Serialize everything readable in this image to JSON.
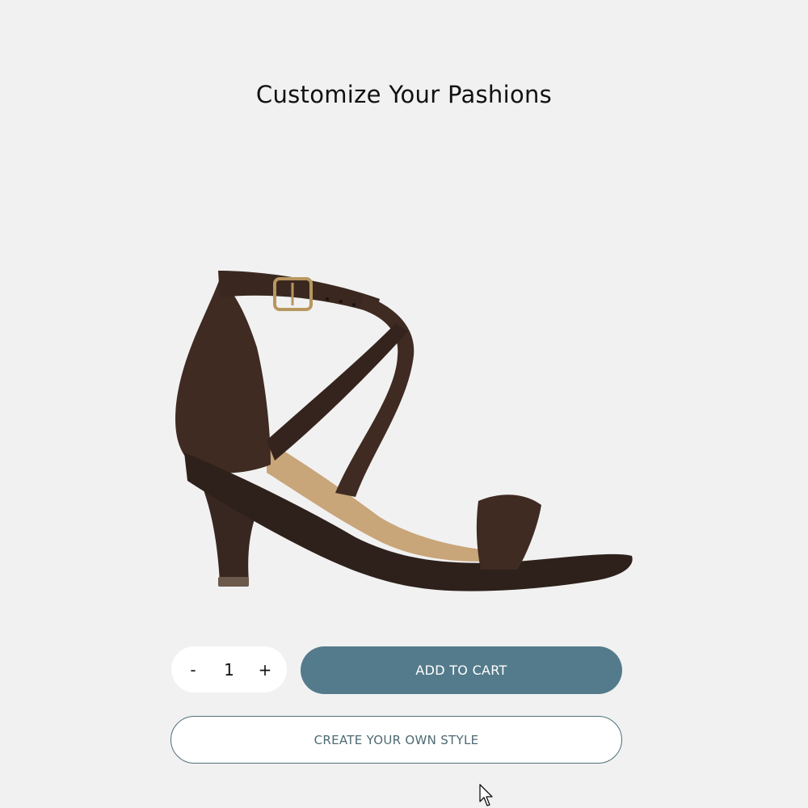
{
  "page": {
    "title": "Customize Your Pashions"
  },
  "product": {
    "image_icon": "brown-strappy-heeled-sandal-image",
    "colors": {
      "leather": "#3f2b22",
      "insole": "#c9a57a",
      "buckle": "#b8975e"
    }
  },
  "quantity": {
    "decrement_label": "-",
    "value": "1",
    "increment_label": "+"
  },
  "actions": {
    "add_to_cart_label": "ADD TO CART",
    "create_style_label": "CREATE YOUR OWN STYLE"
  },
  "theme": {
    "accent": "#547b8b",
    "background": "#f1f1f1"
  }
}
